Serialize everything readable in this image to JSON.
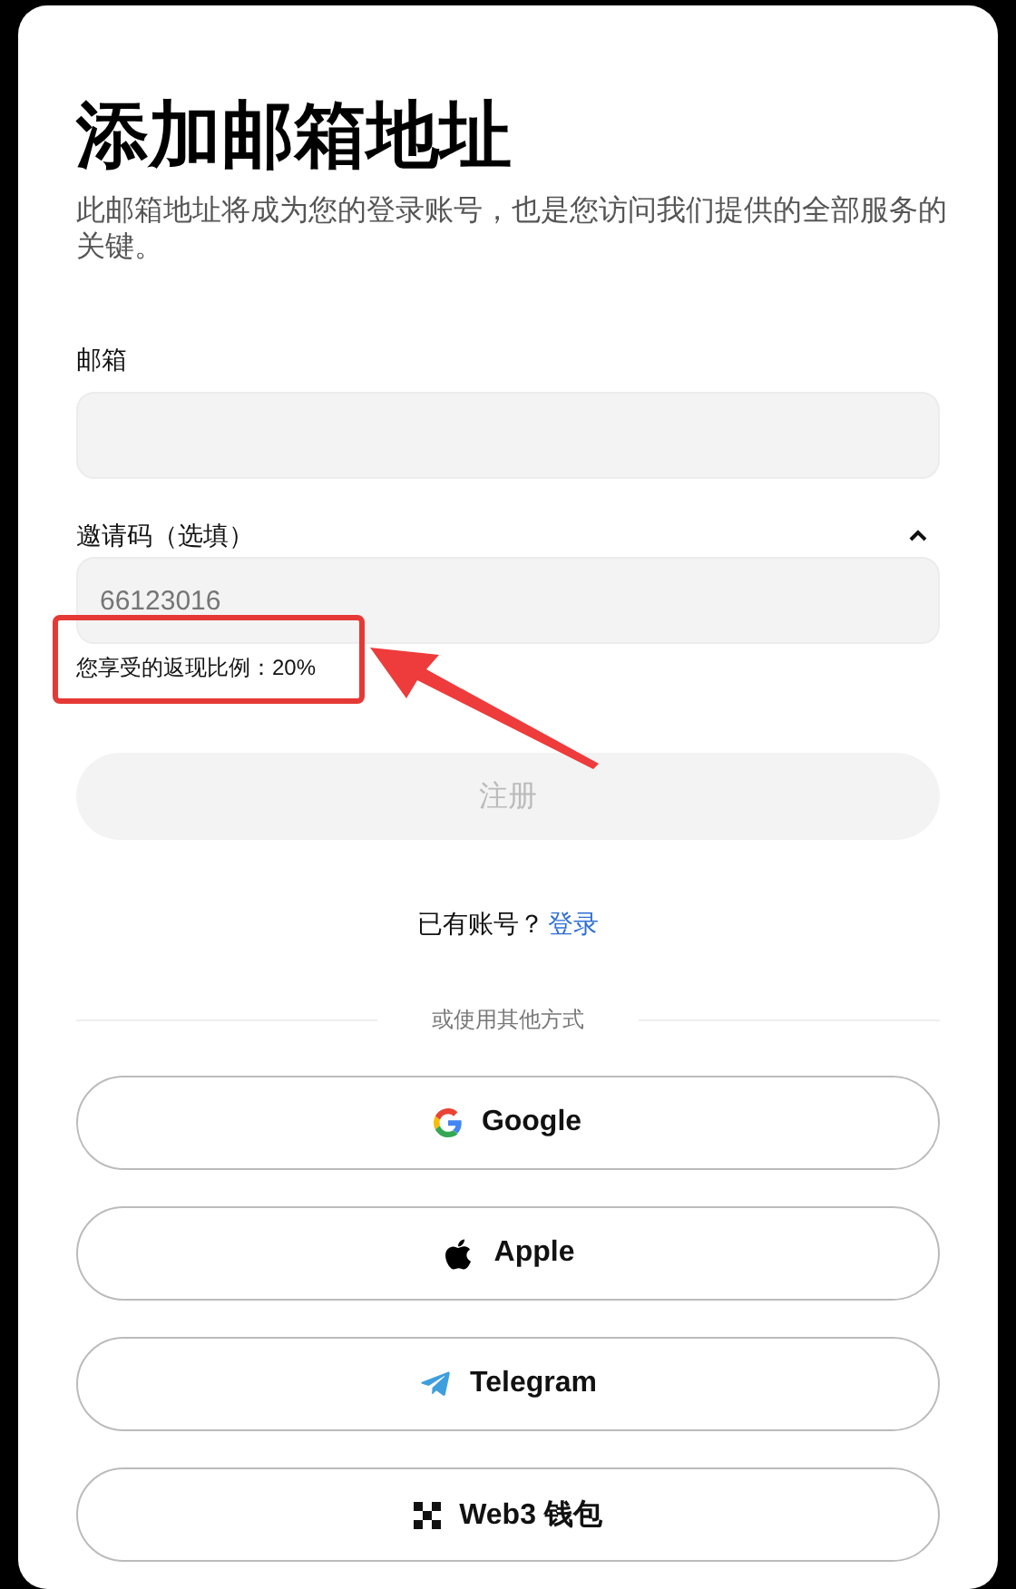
{
  "title": "添加邮箱地址",
  "subtitle": "此邮箱地址将成为您的登录账号，也是您访问我们提供的全部服务的关键。",
  "email": {
    "label": "邮箱"
  },
  "invite_code": {
    "label": "邀请码（选填）",
    "expanded": true,
    "placeholder": "66123016",
    "reward_text": "您享受的返现比例：20%"
  },
  "register_button": {
    "label": "注册",
    "disabled": true
  },
  "login_prompt": {
    "text": "已有账号？",
    "link": "登录"
  },
  "divider_text": "或使用其他方式",
  "social_buttons": [
    {
      "kind": "google",
      "label": "Google"
    },
    {
      "kind": "apple",
      "label": "Apple"
    },
    {
      "kind": "telegram",
      "label": "Telegram"
    },
    {
      "kind": "web3",
      "label": "Web3 钱包"
    }
  ]
}
